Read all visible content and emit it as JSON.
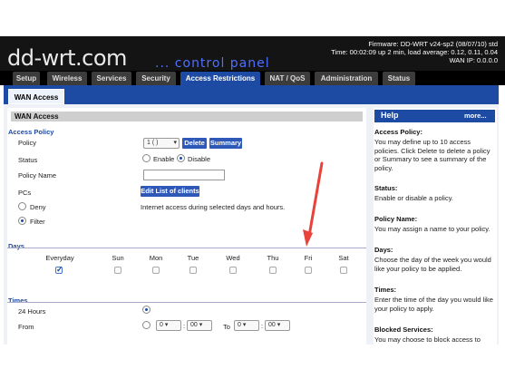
{
  "header": {
    "logo": "dd-wrt.com",
    "subtitle": "... control panel",
    "firmware": "Firmware: DD-WRT v24-sp2 (08/07/10) std",
    "time": "Time: 00:02:09 up 2 min, load average: 0.12, 0.11, 0.04",
    "wan_ip": "WAN IP: 0.0.0.0"
  },
  "tabs": [
    "Setup",
    "Wireless",
    "Services",
    "Security",
    "Access Restrictions",
    "NAT / QoS",
    "Administration",
    "Status"
  ],
  "active_tab": "Access Restrictions",
  "subtab": "WAN Access",
  "section_title": "WAN Access",
  "policy_section": {
    "legend": "Access Policy",
    "policy_label": "Policy",
    "policy_value": "1 ( )",
    "delete_label": "Delete",
    "summary_label": "Summary",
    "status_label": "Status",
    "enable_label": "Enable",
    "disable_label": "Disable",
    "policy_name_label": "Policy Name",
    "policy_name_value": "",
    "pcs_label": "PCs",
    "edit_clients_label": "Edit List of clients",
    "deny_label": "Deny",
    "filter_label": "Filter",
    "internet_access_text": "Internet access during selected days and hours."
  },
  "days_section": {
    "legend": "Days",
    "days": [
      "Everyday",
      "Sun",
      "Mon",
      "Tue",
      "Wed",
      "Thu",
      "Fri",
      "Sat"
    ],
    "checked": [
      true,
      false,
      false,
      false,
      false,
      false,
      false,
      false
    ]
  },
  "times_section": {
    "legend": "Times",
    "hours_label": "24 Hours",
    "from_label": "From",
    "to_label": "To",
    "from_hour": "0",
    "from_min": "00",
    "to_hour": "0",
    "to_min": "00"
  },
  "help": {
    "title": "Help",
    "more": "more...",
    "items": [
      {
        "title": "Access Policy:",
        "body": "You may define up to 10 access policies. Click Delete to delete a policy or Summary to see a summary of the policy."
      },
      {
        "title": "Status:",
        "body": "Enable or disable a policy."
      },
      {
        "title": "Policy Name:",
        "body": "You may assign a name to your policy."
      },
      {
        "title": "Days:",
        "body": "Choose the day of the week you would like your policy to be applied."
      },
      {
        "title": "Times:",
        "body": "Enter the time of the day you would like your policy to apply."
      },
      {
        "title": "Blocked Services:",
        "body": "You may choose to block access to"
      }
    ]
  },
  "colors": {
    "accent": "#1d4aa3",
    "header_bg": "#141414",
    "arrow": "#e8423a"
  }
}
